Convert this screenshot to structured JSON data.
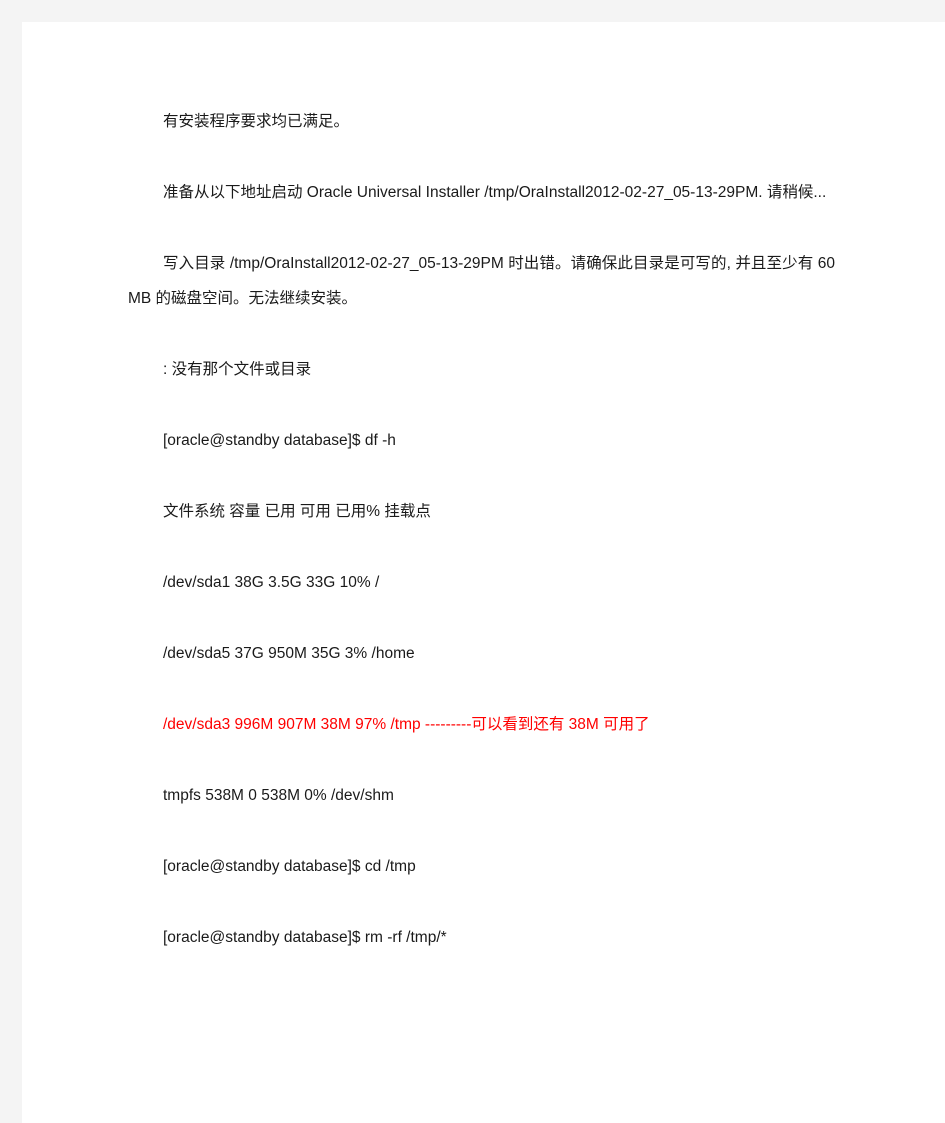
{
  "document": {
    "page_background": "#f4f4f4",
    "sheet_background": "#ffffff",
    "text_color": "#1a1a1a",
    "highlight_color": "#ff0000",
    "paragraphs": [
      {
        "id": "p1",
        "color": "normal",
        "text": "有安装程序要求均已满足。"
      },
      {
        "id": "p2",
        "color": "normal",
        "text": "准备从以下地址启动 Oracle Universal Installer /tmp/OraInstall2012-02-27_05-13-29PM. 请稍候..."
      },
      {
        "id": "p3",
        "color": "normal",
        "text": "写入目录 /tmp/OraInstall2012-02-27_05-13-29PM 时出错。请确保此目录是可写的, 并且至少有 60 MB 的磁盘空间。无法继续安装。"
      },
      {
        "id": "p4",
        "color": "normal",
        "text": ": 没有那个文件或目录"
      },
      {
        "id": "p5",
        "color": "normal",
        "text": "[oracle@standby database]$ df -h"
      },
      {
        "id": "p6",
        "color": "normal",
        "text": "文件系统           容量  已用 可用 已用%  挂载点"
      },
      {
        "id": "p7",
        "color": "normal",
        "text": "/dev/sda1            38G   3.5G    33G   10%  /"
      },
      {
        "id": "p8",
        "color": "normal",
        "text": "/dev/sda5             37G   950M    35G    3%  /home"
      },
      {
        "id": "p9",
        "color": "red",
        "text": "/dev/sda3               996M   907M    38M   97%  /tmp   ---------可以看到还有 38M 可用了"
      },
      {
        "id": "p10",
        "color": "normal",
        "text": "tmpfs                 538M       0   538M    0%  /dev/shm"
      },
      {
        "id": "p11",
        "color": "normal",
        "text": "[oracle@standby database]$ cd /tmp"
      },
      {
        "id": "p12",
        "color": "normal",
        "text": "[oracle@standby database]$ rm -rf /tmp/*"
      }
    ]
  },
  "console_output": {
    "installer_name": "Oracle Universal Installer",
    "temp_dir": "/tmp/OraInstall2012-02-27_05-13-29PM",
    "required_space": "60 MB",
    "prompt": "[oracle@standby database]$",
    "commands": [
      "df -h",
      "cd /tmp",
      "rm -rf /tmp/*"
    ],
    "df_table": {
      "headers": [
        "文件系统",
        "容量",
        "已用",
        "可用",
        "已用%",
        "挂载点"
      ],
      "rows": [
        {
          "filesystem": "/dev/sda1",
          "size": "38G",
          "used": "3.5G",
          "avail": "33G",
          "use_pct": "10%",
          "mounted_on": "/",
          "highlight": false
        },
        {
          "filesystem": "/dev/sda5",
          "size": "37G",
          "used": "950M",
          "avail": "35G",
          "use_pct": "3%",
          "mounted_on": "/home",
          "highlight": false
        },
        {
          "filesystem": "/dev/sda3",
          "size": "996M",
          "used": "907M",
          "avail": "38M",
          "use_pct": "97%",
          "mounted_on": "/tmp",
          "highlight": true,
          "annotation": "---------可以看到还有 38M 可用了"
        },
        {
          "filesystem": "tmpfs",
          "size": "538M",
          "used": "0",
          "avail": "538M",
          "use_pct": "0%",
          "mounted_on": "/dev/shm",
          "highlight": false
        }
      ]
    }
  }
}
